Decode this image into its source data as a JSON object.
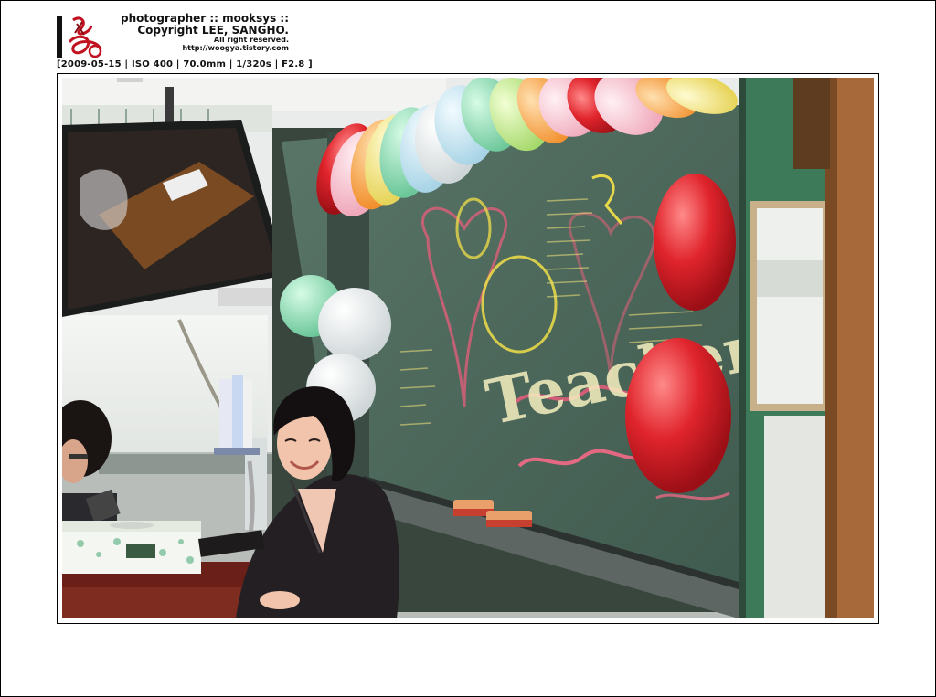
{
  "watermark": {
    "line1": "photographer :: mooksys ::",
    "line2": "Copyright LEE, SANGHO.",
    "line3": "All right reserved.",
    "line4": "http://woogya.tistory.com",
    "logo_icon": "signature-seal-icon"
  },
  "exif": {
    "text": "[2009-05-15 | ISO 400 | 70.0mm | 1/320s | F2.8 ]"
  },
  "photo": {
    "chalkboard_text": "Teachers",
    "colors": {
      "chalkboard": "#4f6a5c",
      "wall_green": "#3d7a5a",
      "balloon_red": "#e0242c",
      "balloon_mint": "#8fe0b6"
    }
  }
}
